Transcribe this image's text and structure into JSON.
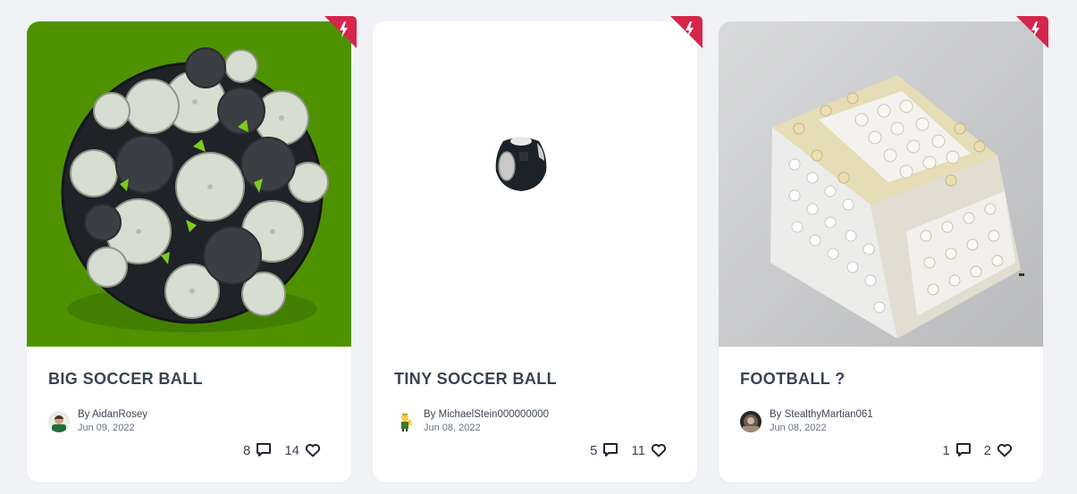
{
  "cards": [
    {
      "title": "BIG SOCCER BALL",
      "by_label": "By AidanRosey",
      "date": "Jun 09, 2022",
      "comments": "8",
      "likes": "14",
      "image_bg": "#4e9200"
    },
    {
      "title": "TINY SOCCER BALL",
      "by_label": "By MichaelStein000000000",
      "date": "Jun 08, 2022",
      "comments": "5",
      "likes": "11",
      "image_bg": "#ffffff"
    },
    {
      "title": "FOOTBALL ?",
      "by_label": "By StealthyMartian061",
      "date": "Jun 08, 2022",
      "comments": "1",
      "likes": "2",
      "image_bg": "#c9cacc"
    }
  ],
  "colors": {
    "page_bg": "#f0f2f6",
    "badge": "#d6254b",
    "title_text": "#394353"
  },
  "icons": {
    "badge": "lightning-bolt-icon",
    "comments": "speech-bubble-icon",
    "likes": "heart-icon"
  }
}
